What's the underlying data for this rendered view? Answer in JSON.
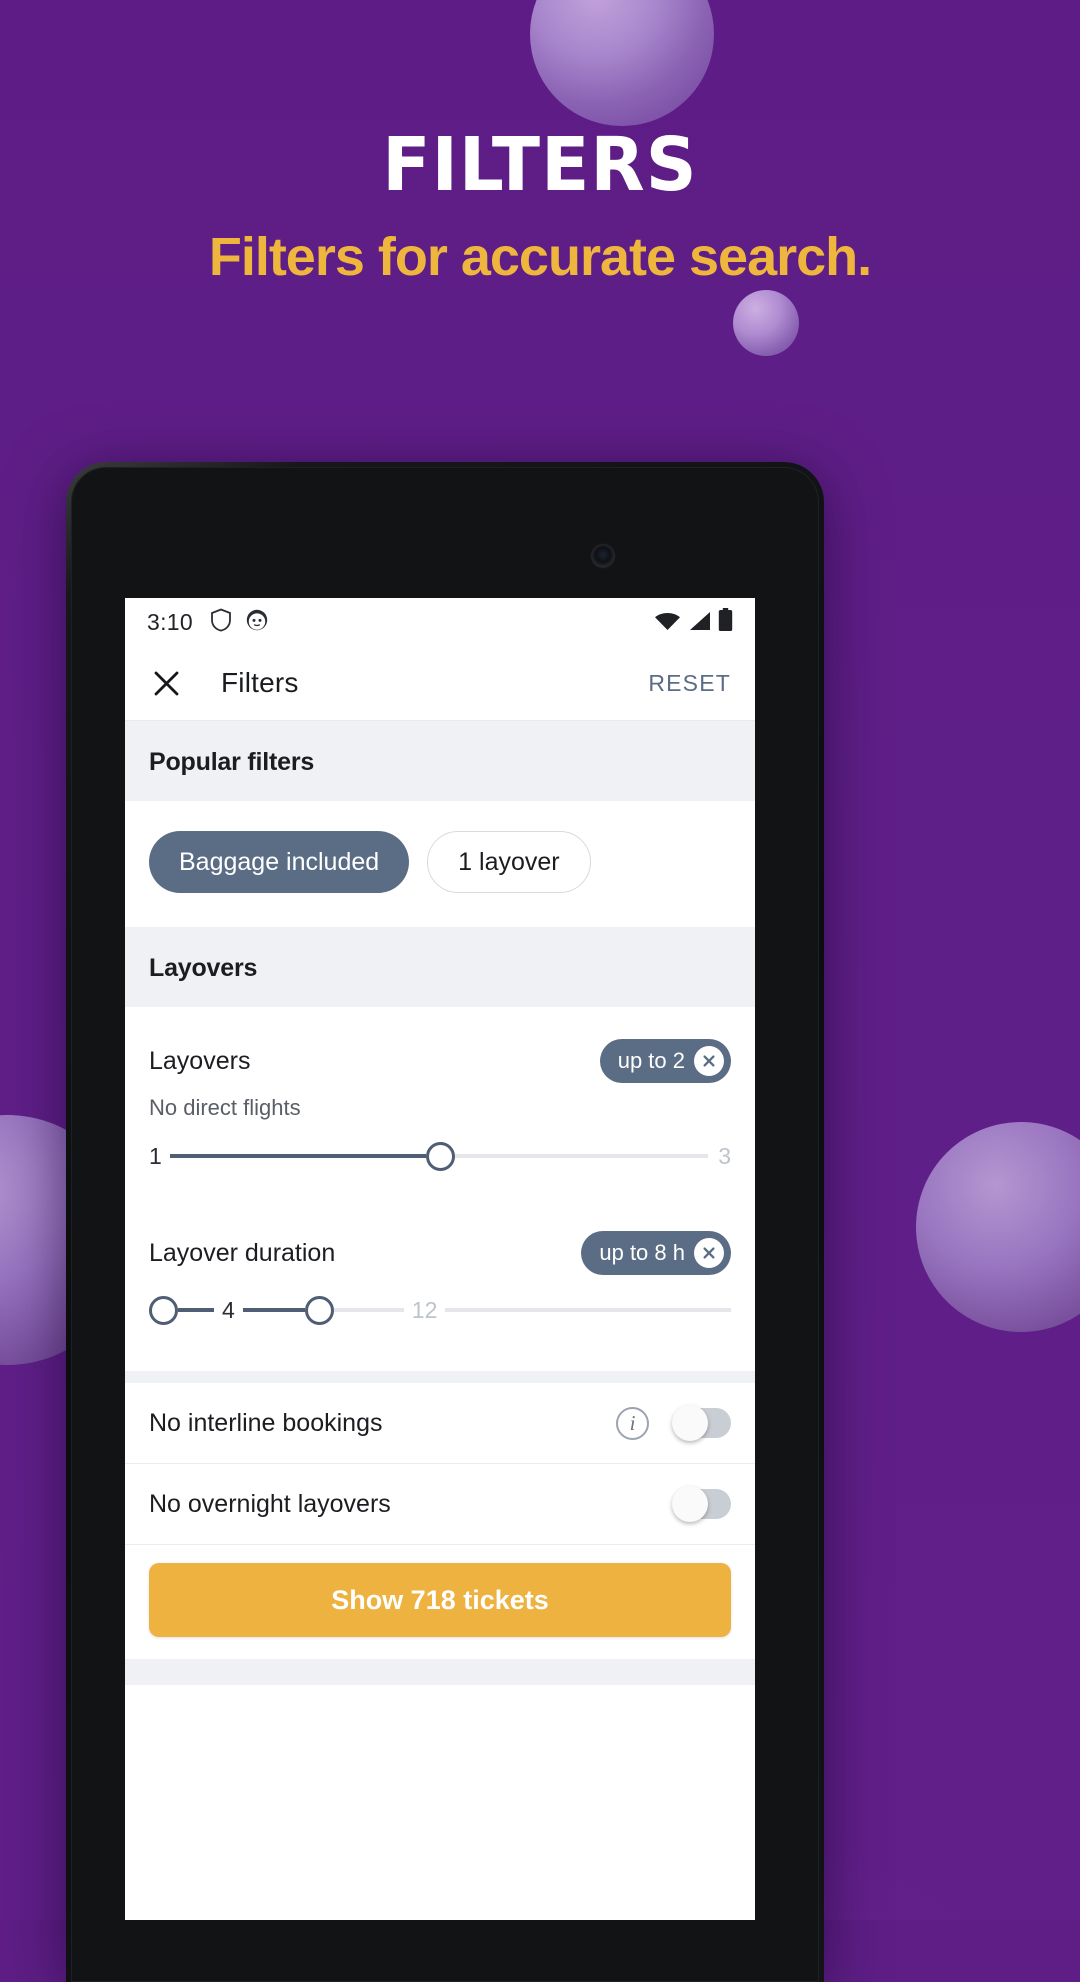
{
  "promo": {
    "title": "FILTERS",
    "subtitle": "Filters for accurate search.",
    "background_color": "#5E1E86",
    "accent_color": "#EFB63D"
  },
  "status_bar": {
    "time": "3:10",
    "left_icons": [
      "shield-icon",
      "face-avatar-icon"
    ],
    "right_icons": [
      "wifi-icon",
      "cellular-signal-icon",
      "battery-icon"
    ]
  },
  "toolbar": {
    "close_icon": "close-icon",
    "title": "Filters",
    "reset_label": "RESET",
    "reset_color": "#5C6C85"
  },
  "sections": {
    "popular_filters": {
      "header": "Popular filters",
      "chips": [
        {
          "label": "Baggage included",
          "selected": true
        },
        {
          "label": "1 layover",
          "selected": false
        }
      ]
    },
    "layovers": {
      "header": "Layovers",
      "rows": [
        {
          "label": "Layovers",
          "badge": "up to 2",
          "badge_clear_icon": "close-circle-icon",
          "sub_label": "No direct flights",
          "slider": {
            "type": "single",
            "min_label": "1",
            "max_label": "3",
            "min": 1,
            "max": 3,
            "value": 2,
            "fill_percent": 50
          }
        },
        {
          "label": "Layover duration",
          "badge": "up to 8 h",
          "badge_clear_icon": "close-circle-icon",
          "sub_label": "",
          "slider": {
            "type": "range",
            "min_label": "4",
            "max_label": "12",
            "min": 0,
            "max": 24,
            "low": 4,
            "high": 8,
            "low_percent": 0,
            "high_percent": 33
          }
        }
      ]
    },
    "toggles": [
      {
        "label": "No interline bookings",
        "has_info_icon": true,
        "info_icon": "info-icon",
        "enabled": false
      },
      {
        "label": "No overnight layovers",
        "has_info_icon": false,
        "info_icon": "",
        "enabled": false
      }
    ]
  },
  "cta": {
    "label": "Show 718 tickets",
    "color": "#EDB240",
    "text_color": "#FFFFFF"
  }
}
